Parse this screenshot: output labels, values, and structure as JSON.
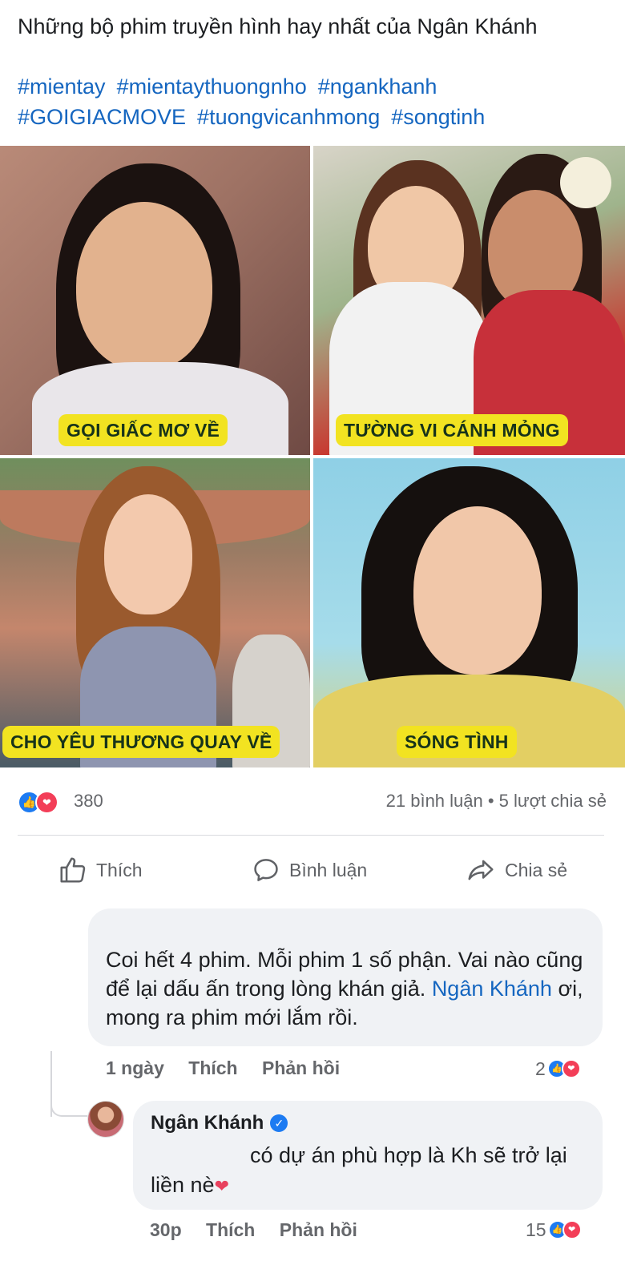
{
  "post": {
    "text": "Những bộ phim truyền hình hay nhất của Ngân Khánh",
    "hashtags": [
      "#mientay",
      "#mientaythuongnho",
      "#ngankhanh",
      "#GOIGIACMOVE",
      "#tuongvicanhmong",
      "#songtinh"
    ]
  },
  "photos": [
    {
      "caption": "GỌI GIẤC MƠ VỀ"
    },
    {
      "caption": "TƯỜNG VI CÁNH MỎNG"
    },
    {
      "caption": "CHO YÊU THƯƠNG QUAY VỀ"
    },
    {
      "caption": "SÓNG TÌNH"
    }
  ],
  "reactions": {
    "count": "380",
    "stats": "21 bình luận • 5 lượt chia sẻ"
  },
  "actions": {
    "like": "Thích",
    "comment": "Bình luận",
    "share": "Chia sẻ"
  },
  "comments": [
    {
      "text_before": "Coi hết 4 phim. Mỗi phim 1 số phận. Vai nào cũng để lại dấu ấn trong lòng khán giả. ",
      "mention": "Ngân Khánh",
      "text_after": " ơi, mong ra phim mới lắm rồi.",
      "time": "1 ngày",
      "like": "Thích",
      "reply": "Phản hồi",
      "reactions": "2"
    },
    {
      "author": "Ngân Khánh",
      "text": "có dự án phù hợp là Kh sẽ trở lại liền nè",
      "time": "30p",
      "like": "Thích",
      "reply": "Phản hồi",
      "reactions": "15"
    }
  ],
  "colors": {
    "link": "#1566c0",
    "caption_bg": "#f2e321",
    "like_blue": "#1d7bf2",
    "love_red": "#f33e58"
  }
}
